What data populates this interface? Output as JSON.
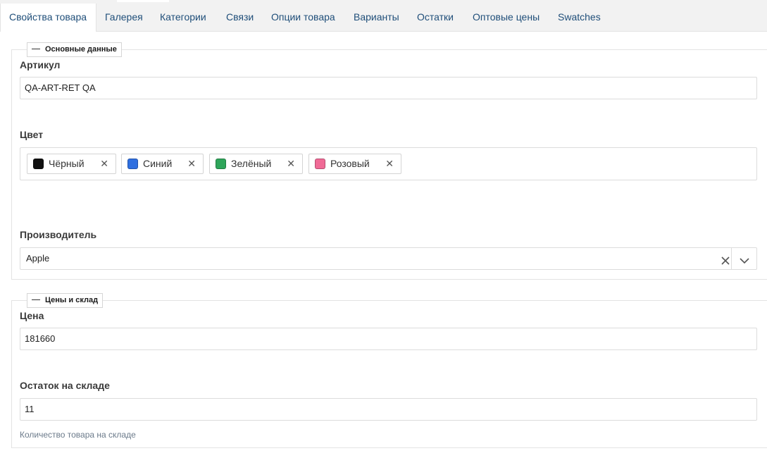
{
  "tabs": [
    {
      "label": "Свойства товара",
      "active": true
    },
    {
      "label": "Галерея",
      "active": false
    },
    {
      "label": "Категории",
      "active": false
    },
    {
      "label": "Связи",
      "active": false
    },
    {
      "label": "Опции товара",
      "active": false
    },
    {
      "label": "Варианты",
      "active": false
    },
    {
      "label": "Остатки",
      "active": false
    },
    {
      "label": "Оптовые цены",
      "active": false
    },
    {
      "label": "Swatches",
      "active": false
    }
  ],
  "basic": {
    "legend": "Основные данные",
    "sku_label": "Артикул",
    "sku_value": "QA-ART-RET QA",
    "color_label": "Цвет",
    "colors": [
      {
        "label": "Чёрный",
        "hex": "#111111"
      },
      {
        "label": "Синий",
        "hex": "#2f6fe0"
      },
      {
        "label": "Зелёный",
        "hex": "#2ea55a"
      },
      {
        "label": "Розовый",
        "hex": "#f06a96"
      }
    ],
    "manufacturer_label": "Производитель",
    "manufacturer_value": "Apple"
  },
  "stock": {
    "legend": "Цены и склад",
    "price_label": "Цена",
    "price_value": "181660",
    "qty_label": "Остаток на складе",
    "qty_value": "11",
    "qty_help": "Количество товара на складе"
  },
  "icons": {
    "remove": "close-icon",
    "clear": "close-icon",
    "dropdown": "chevron-down-icon",
    "collapse": "minus-icon"
  },
  "theme": {
    "tab_text": "#1f4e79",
    "border": "#dcdcdc",
    "help_text": "#6b7a8a"
  }
}
